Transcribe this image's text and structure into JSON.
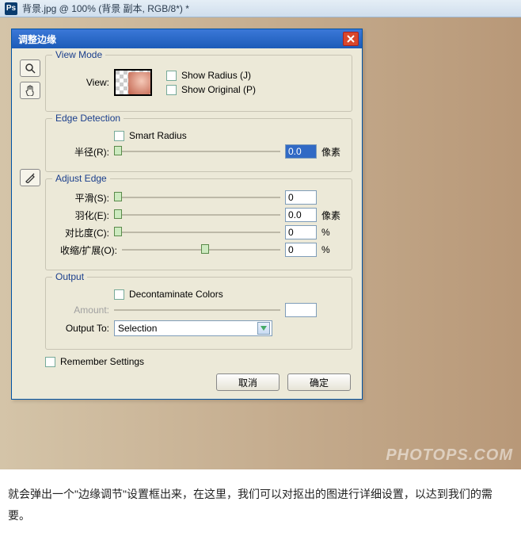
{
  "topbar": {
    "title": "背景.jpg @ 100% (背景 副本, RGB/8*) *"
  },
  "dialog": {
    "title": "调整边缘",
    "view_mode": {
      "legend": "View Mode",
      "view_label": "View:",
      "show_radius": "Show Radius (J)",
      "show_original": "Show Original (P)"
    },
    "edge_detection": {
      "legend": "Edge Detection",
      "smart_radius": "Smart Radius",
      "radius_label": "半径(R):",
      "radius_value": "0.0",
      "radius_unit": "像素"
    },
    "adjust_edge": {
      "legend": "Adjust Edge",
      "smooth_label": "平滑(S):",
      "smooth_value": "0",
      "feather_label": "羽化(E):",
      "feather_value": "0.0",
      "feather_unit": "像素",
      "contrast_label": "对比度(C):",
      "contrast_value": "0",
      "contrast_unit": "%",
      "shift_label": "收缩/扩展(O):",
      "shift_value": "0",
      "shift_unit": "%"
    },
    "output": {
      "legend": "Output",
      "decontaminate": "Decontaminate Colors",
      "amount_label": "Amount:",
      "amount_value": "",
      "output_to_label": "Output To:",
      "output_to_value": "Selection"
    },
    "remember": "Remember Settings",
    "cancel": "取消",
    "ok": "确定"
  },
  "caption": "就会弹出一个\"边缘调节\"设置框出来，在这里，我们可以对抠出的图进行详细设置，以达到我们的需要。",
  "watermark": "PHOTOPS.COM"
}
